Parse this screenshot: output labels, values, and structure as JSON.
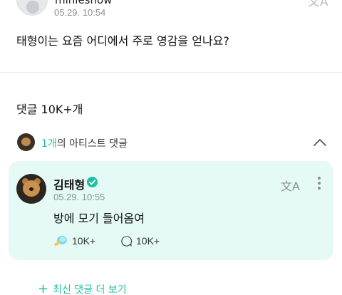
{
  "post": {
    "author": "minieshow",
    "time": "05.29. 10:54",
    "translate_icon": "translate-icon",
    "body": "태형이는 요즘 어디에서 주로 영감을 얻나요?"
  },
  "comments": {
    "header": "댓글 10K+개"
  },
  "artist_comments_row": {
    "count_text": "1개",
    "label_text": "의 아티스트 댓글",
    "chevron": "chevron-up-icon"
  },
  "artist_comment": {
    "name": "김태형",
    "verified_icon": "verified-badge-icon",
    "time": "05.29. 10:55",
    "text": "방에 모기 들어옴여",
    "like_count": "10K+",
    "reply_count": "10K+",
    "translate_icon": "translate-icon",
    "more_icon": "more-vertical-icon"
  },
  "more_comments": {
    "label": "최신 댓글 더 보기"
  },
  "colors": {
    "accent": "#1fbfa2",
    "card_bg": "#e5faf5",
    "muted": "#8a8f95"
  }
}
